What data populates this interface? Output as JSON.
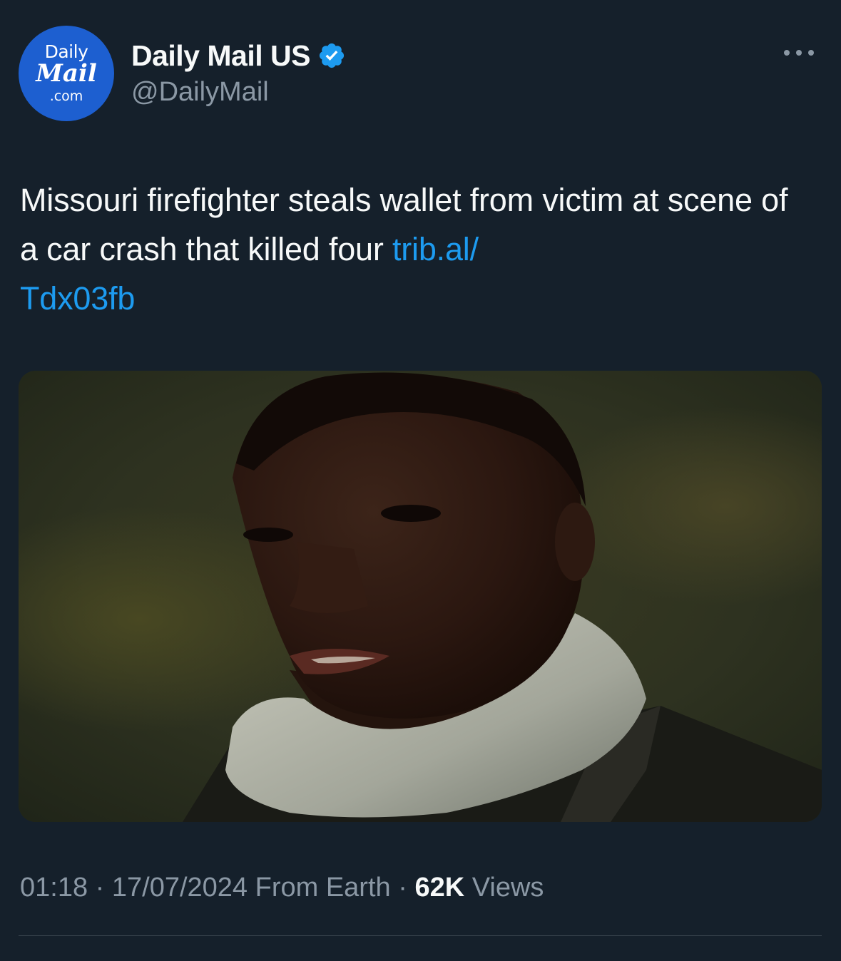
{
  "account": {
    "avatar_logo": {
      "line1": "Daily",
      "line2": "Mail",
      "line3": ".com"
    },
    "display_name": "Daily Mail US",
    "handle": "@DailyMail",
    "verified_icon": "verified-badge-icon"
  },
  "more_icon": "more-options-icon",
  "tweet": {
    "text": "Missouri firefighter steals wallet from victim at scene of a car crash that killed four ",
    "link": "trib.al/\nTdx03fb"
  },
  "media": {
    "icon": "photo"
  },
  "meta": {
    "time": "01:18",
    "sep1": " · ",
    "date": "17/07/2024",
    "source": " From Earth",
    "sep2": " · ",
    "views_count": "62K",
    "views_label": " Views"
  },
  "colors": {
    "background": "#15202b",
    "text": "#f7f9f9",
    "secondary_text": "#8b98a5",
    "link": "#1d9bf0",
    "verified": "#1d9bf0",
    "avatar_bg": "#1d5fd0",
    "divider": "#38444d"
  }
}
